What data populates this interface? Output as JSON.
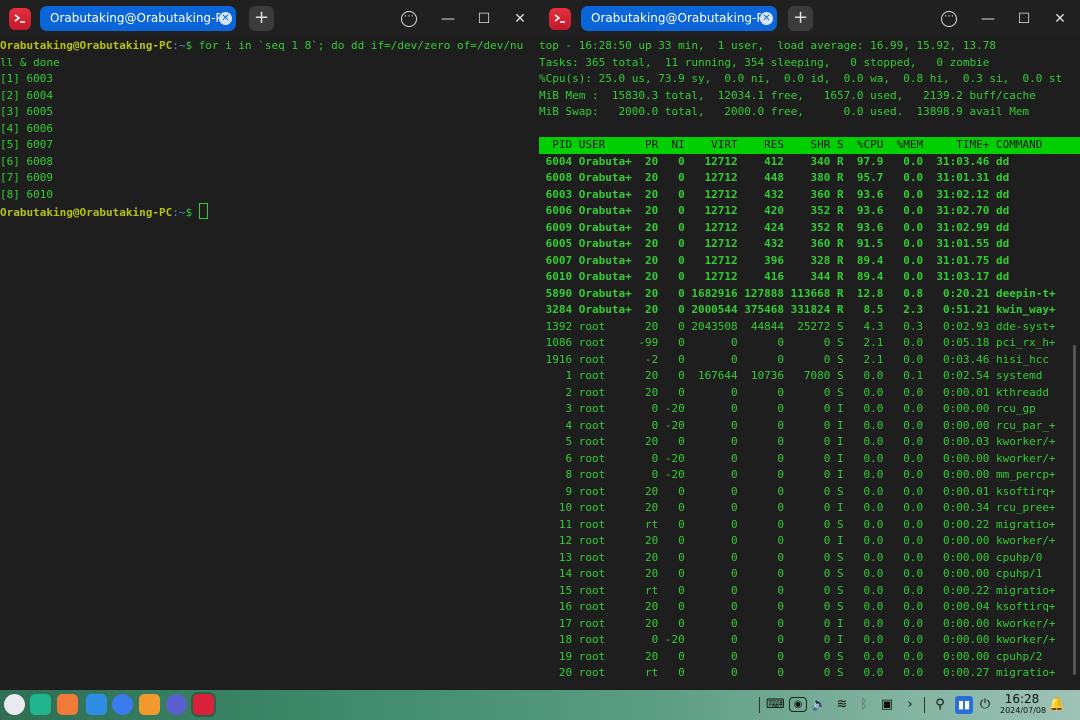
{
  "left_window": {
    "tab_title": "Orabutaking@Orabutaking-PC: ~",
    "lines": [
      {
        "type": "prompt",
        "user": "Orabutaking@Orabutaking-PC",
        "path": ":~",
        "sym": "$ ",
        "cmd": "for i in `seq 1 8`; do dd if=/dev/zero of=/dev/nu"
      },
      {
        "type": "text",
        "text": "ll & done"
      },
      {
        "type": "text",
        "text": "[1] 6003"
      },
      {
        "type": "text",
        "text": "[2] 6004"
      },
      {
        "type": "text",
        "text": "[3] 6005"
      },
      {
        "type": "text",
        "text": "[4] 6006"
      },
      {
        "type": "text",
        "text": "[5] 6007"
      },
      {
        "type": "text",
        "text": "[6] 6008"
      },
      {
        "type": "text",
        "text": "[7] 6009"
      },
      {
        "type": "text",
        "text": "[8] 6010"
      },
      {
        "type": "prompt",
        "user": "Orabutaking@Orabutaking-PC",
        "path": ":~",
        "sym": "$ ",
        "cmd": "",
        "cursor": true
      }
    ]
  },
  "right_window": {
    "tab_title": "Orabutaking@Orabutaking-PC: ~",
    "summary": [
      "top - 16:28:50 up 33 min,  1 user,  load average: 16.99, 15.92, 13.78",
      "Tasks: 365 total,  11 running, 354 sleeping,   0 stopped,   0 zombie",
      "%Cpu(s): 25.0 us, 73.9 sy,  0.0 ni,  0.0 id,  0.0 wa,  0.8 hi,  0.3 si,  0.0 st",
      "MiB Mem :  15830.3 total,  12034.1 free,   1657.0 used,   2139.2 buff/cache",
      "MiB Swap:   2000.0 total,   2000.0 free,      0.0 used.  13898.9 avail Mem"
    ],
    "table_header": "  PID USER      PR  NI    VIRT    RES    SHR S  %CPU  %MEM     TIME+ COMMAND",
    "rows": [
      {
        "bold": true,
        "text": " 6004 Orabuta+  20   0   12712    412    340 R  97.9   0.0  31:03.46 dd"
      },
      {
        "bold": true,
        "text": " 6008 Orabuta+  20   0   12712    448    380 R  95.7   0.0  31:01.31 dd"
      },
      {
        "bold": true,
        "text": " 6003 Orabuta+  20   0   12712    432    360 R  93.6   0.0  31:02.12 dd"
      },
      {
        "bold": true,
        "text": " 6006 Orabuta+  20   0   12712    420    352 R  93.6   0.0  31:02.70 dd"
      },
      {
        "bold": true,
        "text": " 6009 Orabuta+  20   0   12712    424    352 R  93.6   0.0  31:02.99 dd"
      },
      {
        "bold": true,
        "text": " 6005 Orabuta+  20   0   12712    432    360 R  91.5   0.0  31:01.55 dd"
      },
      {
        "bold": true,
        "text": " 6007 Orabuta+  20   0   12712    396    328 R  89.4   0.0  31:01.75 dd"
      },
      {
        "bold": true,
        "text": " 6010 Orabuta+  20   0   12712    416    344 R  89.4   0.0  31:03.17 dd"
      },
      {
        "bold": true,
        "text": " 5890 Orabuta+  20   0 1682916 127888 113668 R  12.8   0.8   0:20.21 deepin-t+"
      },
      {
        "bold": true,
        "text": " 3284 Orabuta+  20   0 2000544 375468 331824 R   8.5   2.3   0:51.21 kwin_way+"
      },
      {
        "bold": false,
        "text": " 1392 root      20   0 2043508  44844  25272 S   4.3   0.3   0:02.93 dde-syst+"
      },
      {
        "bold": false,
        "text": " 1086 root     -99   0       0      0      0 S   2.1   0.0   0:05.18 pci_rx_h+"
      },
      {
        "bold": false,
        "text": " 1916 root      -2   0       0      0      0 S   2.1   0.0   0:03.46 hisi_hcc"
      },
      {
        "bold": false,
        "text": "    1 root      20   0  167644  10736   7080 S   0.0   0.1   0:02.54 systemd"
      },
      {
        "bold": false,
        "text": "    2 root      20   0       0      0      0 S   0.0   0.0   0:00.01 kthreadd"
      },
      {
        "bold": false,
        "text": "    3 root       0 -20       0      0      0 I   0.0   0.0   0:00.00 rcu_gp"
      },
      {
        "bold": false,
        "text": "    4 root       0 -20       0      0      0 I   0.0   0.0   0:00.00 rcu_par_+"
      },
      {
        "bold": false,
        "text": "    5 root      20   0       0      0      0 I   0.0   0.0   0:00.03 kworker/+"
      },
      {
        "bold": false,
        "text": "    6 root       0 -20       0      0      0 I   0.0   0.0   0:00.00 kworker/+"
      },
      {
        "bold": false,
        "text": "    8 root       0 -20       0      0      0 I   0.0   0.0   0:00.00 mm_percp+"
      },
      {
        "bold": false,
        "text": "    9 root      20   0       0      0      0 S   0.0   0.0   0:00.01 ksoftirq+"
      },
      {
        "bold": false,
        "text": "   10 root      20   0       0      0      0 I   0.0   0.0   0:00.34 rcu_pree+"
      },
      {
        "bold": false,
        "text": "   11 root      rt   0       0      0      0 S   0.0   0.0   0:00.22 migratio+"
      },
      {
        "bold": false,
        "text": "   12 root      20   0       0      0      0 I   0.0   0.0   0:00.00 kworker/+"
      },
      {
        "bold": false,
        "text": "   13 root      20   0       0      0      0 S   0.0   0.0   0:00.00 cpuhp/0"
      },
      {
        "bold": false,
        "text": "   14 root      20   0       0      0      0 S   0.0   0.0   0:00.00 cpuhp/1"
      },
      {
        "bold": false,
        "text": "   15 root      rt   0       0      0      0 S   0.0   0.0   0:00.22 migratio+"
      },
      {
        "bold": false,
        "text": "   16 root      20   0       0      0      0 S   0.0   0.0   0:00.04 ksoftirq+"
      },
      {
        "bold": false,
        "text": "   17 root      20   0       0      0      0 I   0.0   0.0   0:00.00 kworker/+"
      },
      {
        "bold": false,
        "text": "   18 root       0 -20       0      0      0 I   0.0   0.0   0:00.00 kworker/+"
      },
      {
        "bold": false,
        "text": "   19 root      20   0       0      0      0 S   0.0   0.0   0:00.00 cpuhp/2"
      },
      {
        "bold": false,
        "text": "   20 root      rt   0       0      0      0 S   0.0   0.0   0:00.27 migratio+"
      }
    ]
  },
  "window_controls": {
    "new_tab": "+",
    "menu": "⋯",
    "minimize": "—",
    "maximize": "☐",
    "close": "✕"
  },
  "taskbar": {
    "apps": [
      {
        "name": "launcher",
        "color": "#e9e9f0"
      },
      {
        "name": "multitask-view",
        "color": "#1fb58f"
      },
      {
        "name": "app-store",
        "color": "#f07a3a"
      },
      {
        "name": "file-manager",
        "color": "#2e8ee6"
      },
      {
        "name": "browser",
        "color": "#3a7bef"
      },
      {
        "name": "archive-manager",
        "color": "#f29a2e"
      },
      {
        "name": "settings",
        "color": "#5a5fd0"
      },
      {
        "name": "terminal",
        "color": "#d9223a"
      }
    ],
    "clock_time": "16:28",
    "clock_date": "2024/07/08"
  },
  "colors": {
    "accent": "#0a66d8",
    "terminal_text": "#33cc33",
    "prompt_user": "#b5c214",
    "prompt_path": "#3b8cff",
    "top_header_bg": "#00d000"
  }
}
